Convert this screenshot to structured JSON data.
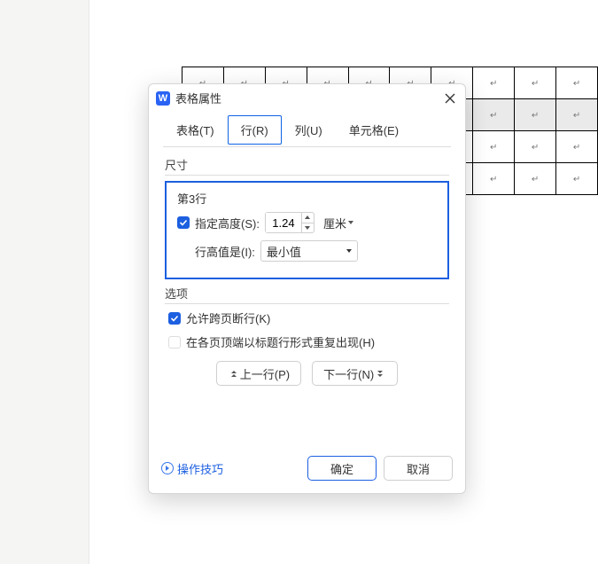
{
  "dialog": {
    "app_icon_letter": "W",
    "title": "表格属性",
    "tabs": {
      "table": "表格(T)",
      "row": "行(R)",
      "column": "列(U)",
      "cell": "单元格(E)",
      "active": "row"
    },
    "size_section_title": "尺寸",
    "row_label": "第3行",
    "specify_height": {
      "checked": true,
      "label": "指定高度(S):",
      "value": "1.24",
      "unit": "厘米"
    },
    "row_height_is": {
      "label": "行高值是(I):",
      "value": "最小值"
    },
    "options_section_title": "选项",
    "allow_break": {
      "checked": true,
      "label": "允许跨页断行(K)"
    },
    "repeat_header": {
      "checked": false,
      "enabled": false,
      "label": "在各页顶端以标题行形式重复出现(H)"
    },
    "prev_row": "上一行(P)",
    "next_row": "下一行(N)",
    "tips": "操作技巧",
    "ok": "确定",
    "cancel": "取消"
  },
  "bg_paragraph_mark": "↵"
}
